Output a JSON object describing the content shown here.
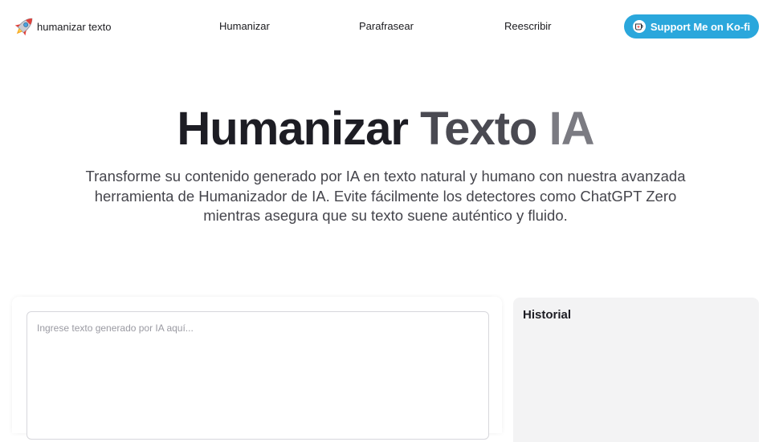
{
  "nav": {
    "brand_label": "humanizar texto",
    "brand_icon": "rocket-icon",
    "links": [
      "Humanizar",
      "Parafrasear",
      "Reescribir"
    ],
    "support_label": "Support Me on Ko-fi",
    "support_icon": "kofi-cup-icon"
  },
  "hero": {
    "title_part1": "Humanizar ",
    "title_part2": "Texto ",
    "title_part3": "IA",
    "subtitle": "Transforme su contenido generado por IA en texto natural y humano con nuestra avanzada herramienta de Humanizador de IA. Evite fácilmente los detectores como ChatGPT Zero mientras asegura que su texto suene auténtico y fluido."
  },
  "editor": {
    "placeholder": "Ingrese texto generado por IA aquí...",
    "value": ""
  },
  "history": {
    "title": "Historial"
  },
  "colors": {
    "accent": "#2aa7dc",
    "history_bg": "#f3f3f4",
    "title_dark": "#1d1d24",
    "title_light": "#7b7b82"
  }
}
